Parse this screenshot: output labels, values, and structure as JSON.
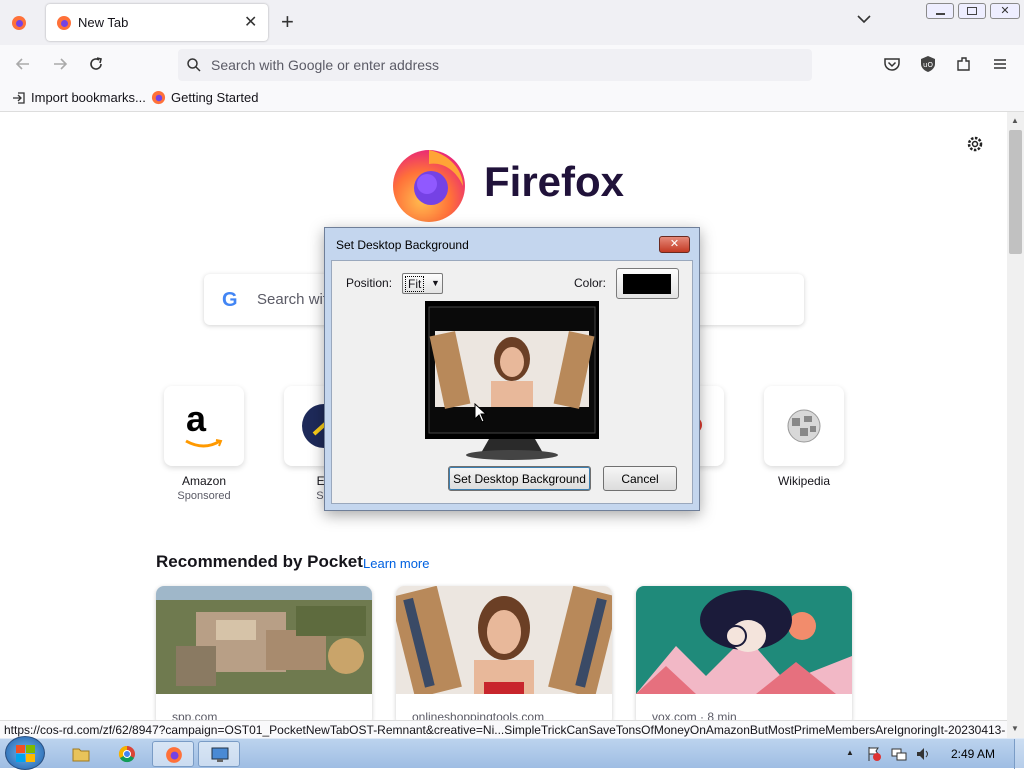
{
  "browser": {
    "tab_title": "New Tab",
    "url_placeholder": "Search with Google or enter address",
    "bookmarks": [
      "Import bookmarks...",
      "Getting Started"
    ]
  },
  "newtab": {
    "brand": "Firefox",
    "search_placeholder": "Search wit",
    "shortcuts": [
      {
        "label": "Amazon",
        "sub": "Sponsored"
      },
      {
        "label": "Expe",
        "sub": "Spon"
      },
      {
        "label": "Wikipedia",
        "sub": ""
      }
    ],
    "pocket_title": "Recommended by Pocket",
    "pocket_link": "Learn more",
    "cards": [
      {
        "source": "spp.com"
      },
      {
        "source": "onlineshoppingtools.com"
      },
      {
        "source": "vox.com · 8 min"
      }
    ]
  },
  "dialog": {
    "title": "Set Desktop Background",
    "position_label": "Position:",
    "position_value": "Fit",
    "color_label": "Color:",
    "ok_label": "Set Desktop Background",
    "cancel_label": "Cancel"
  },
  "status_url": "https://cos-rd.com/zf/62/8947?campaign=OST01_PocketNewTabOST-Remnant&creative=Ni...SimpleTrickCanSaveTonsOfMoneyOnAmazonButMostPrimeMembersAreIgnoringIt-20230413-",
  "taskbar": {
    "clock": "2:49 AM"
  },
  "colors": {
    "accent": "#0061e0",
    "pocket_link": "#0061e0",
    "taskbar": "#a9c5e8"
  }
}
